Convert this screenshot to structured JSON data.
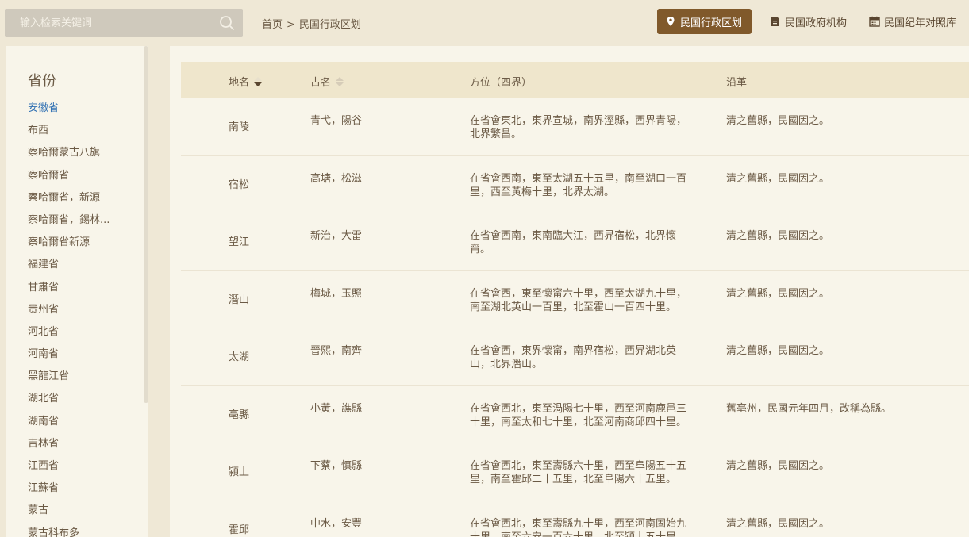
{
  "search": {
    "placeholder": "输入检索关键词"
  },
  "breadcrumb": {
    "home": "首页",
    "separator": ">",
    "current": "民国行政区划"
  },
  "nav": {
    "admin_division": "民国行政区划",
    "gov_agencies": "民国政府机构",
    "calendar": "民国纪年对照库"
  },
  "sidebar": {
    "title": "省份",
    "items": [
      {
        "label": "安徽省",
        "active": true
      },
      {
        "label": "布西"
      },
      {
        "label": "察哈爾蒙古八旗"
      },
      {
        "label": "察哈爾省"
      },
      {
        "label": "察哈爾省，新源"
      },
      {
        "label": "察哈爾省，錫林..."
      },
      {
        "label": "察哈爾省新源"
      },
      {
        "label": "福建省"
      },
      {
        "label": "甘肅省"
      },
      {
        "label": "贵州省"
      },
      {
        "label": "河北省"
      },
      {
        "label": "河南省"
      },
      {
        "label": "黑龍江省"
      },
      {
        "label": "湖北省"
      },
      {
        "label": "湖南省"
      },
      {
        "label": "吉林省"
      },
      {
        "label": "江西省"
      },
      {
        "label": "江蘇省"
      },
      {
        "label": "蒙古"
      },
      {
        "label": "蒙古科布多"
      }
    ]
  },
  "table": {
    "headers": {
      "name": "地名",
      "old_name": "古名",
      "position": "方位（四界）",
      "history": "沿革"
    },
    "rows": [
      {
        "name": "南陵",
        "old_name": "青弋，陽谷",
        "position": "在省會東北，東界宣城，南界涇縣，西界青陽，北界繁昌。",
        "history": "清之舊縣，民國因之。"
      },
      {
        "name": "宿松",
        "old_name": "高塘，松滋",
        "position": "在省會西南，東至太湖五十五里，南至湖口一百里，西至黃梅十里，北界太湖。",
        "history": "清之舊縣，民國因之。"
      },
      {
        "name": "望江",
        "old_name": "新治，大雷",
        "position": "在省會西南，東南臨大江，西界宿松，北界懷甯。",
        "history": "清之舊縣，民國因之。"
      },
      {
        "name": "潛山",
        "old_name": "梅城，玉照",
        "position": "在省會西，東至懷甯六十里，西至太湖九十里，南至湖北英山一百里，北至霍山一百四十里。",
        "history": "清之舊縣，民國因之。"
      },
      {
        "name": "太湖",
        "old_name": "晉熙，南齊",
        "position": "在省會西，東界懷甯，南界宿松，西界湖北英山，北界潛山。",
        "history": "清之舊縣，民國因之。"
      },
      {
        "name": "亳縣",
        "old_name": "小黃，譙縣",
        "position": "在省會西北，東至渦陽七十里，西至河南鹿邑三十里，南至太和七十里，北至河南商邱四十里。",
        "history": "舊亳州，民國元年四月，改稱為縣。"
      },
      {
        "name": "潁上",
        "old_name": "下蔡，慎縣",
        "position": "在省會西北，東至壽縣六十里，西至阜陽五十五里，南至霍邱二十五里，北至阜陽六十五里。",
        "history": "清之舊縣，民國因之。"
      },
      {
        "name": "霍邱",
        "old_name": "中水，安豐",
        "position": "在省會西北，東至壽縣九十里，西至河南固始九十里，南至六安一百六十里，北至潁上五十里。",
        "history": "清之舊縣，民國因之。"
      }
    ]
  }
}
